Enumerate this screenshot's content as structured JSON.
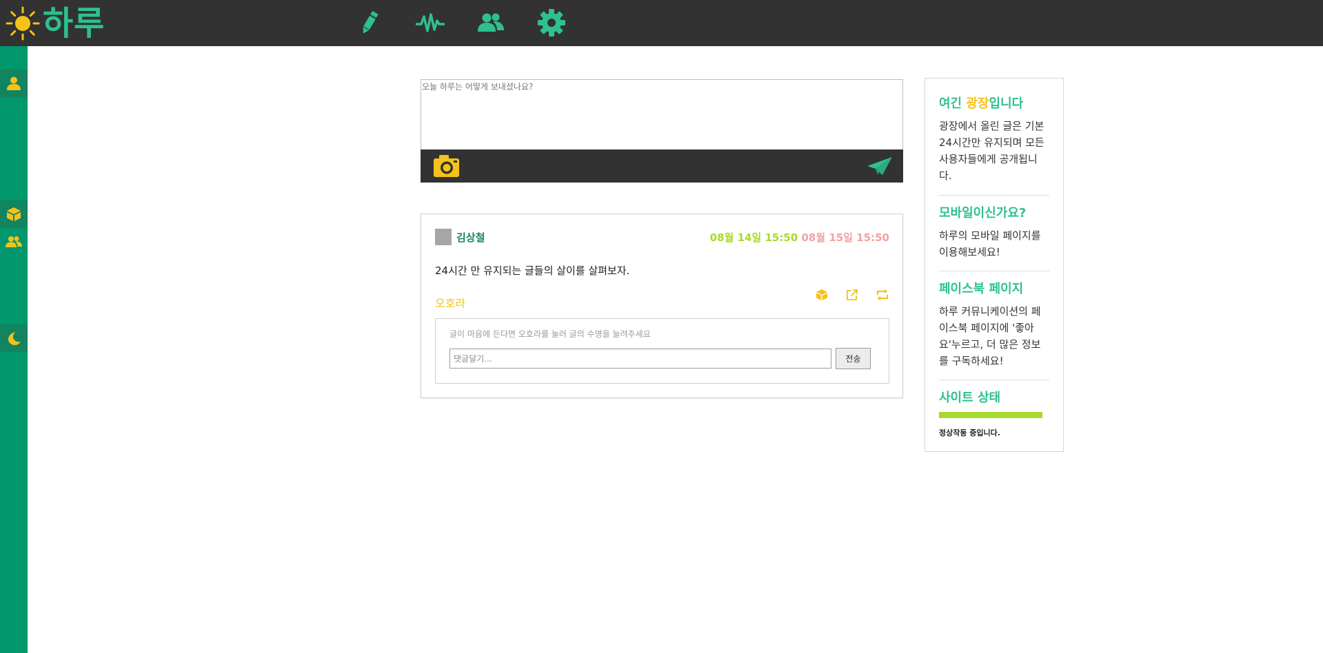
{
  "app": {
    "name": "하루",
    "colors": {
      "brand": "#2ec08f",
      "accent": "#f4c21a",
      "topbar": "#323232",
      "rail": "#00976c"
    }
  },
  "topnav": [
    {
      "name": "write",
      "icon": "pencil-icon"
    },
    {
      "name": "activity",
      "icon": "pulse-icon"
    },
    {
      "name": "friends",
      "icon": "users-icon"
    },
    {
      "name": "settings",
      "icon": "gear-icon"
    }
  ],
  "rail": [
    {
      "name": "profile",
      "icon": "user-icon"
    },
    {
      "name": "aurora",
      "icon": "cube-icon"
    },
    {
      "name": "friends",
      "icon": "users-icon"
    },
    {
      "name": "night-mode",
      "icon": "moon-icon"
    }
  ],
  "composer": {
    "placeholder": "오늘 하루는 어떻게 보내셨나요?",
    "camera_icon": "camera-icon",
    "send_icon": "paper-plane-icon"
  },
  "post": {
    "author": "김상철",
    "date_posted": "08월 14일 15:50",
    "date_expires": "08월 15일 15:50",
    "body": "24시간 만 유지되는 글들의 살이를 살펴보자.",
    "aurora_label": "오호라",
    "actions": [
      "cube-icon",
      "share-icon",
      "repost-icon"
    ],
    "comment": {
      "hint": "글이 마음에 든다면 오호라를 눌러 글의 수명을 늘려주세요",
      "placeholder": "댓글달기...",
      "submit_label": "전송"
    }
  },
  "sidebar": {
    "plaza": {
      "title_pre": "여긴 ",
      "title_hl": "광장",
      "title_post": "입니다",
      "text": "광장에서 올린 글은 기본 24시간만 유지되며 모든 사용자들에게 공개됩니다."
    },
    "mobile": {
      "title": "모바일이신가요?",
      "text": "하루의 모바일 페이지를 이용해보세요!"
    },
    "facebook": {
      "title": "페이스북 페이지",
      "text": "하루 커뮤니케이션의 페이스북 페이지에 '좋아요'누르고, 더 많은 정보를 구독하세요!"
    },
    "status": {
      "title": "사이트 상태",
      "level": 1.0,
      "text": "정상작동 중입니다."
    }
  }
}
